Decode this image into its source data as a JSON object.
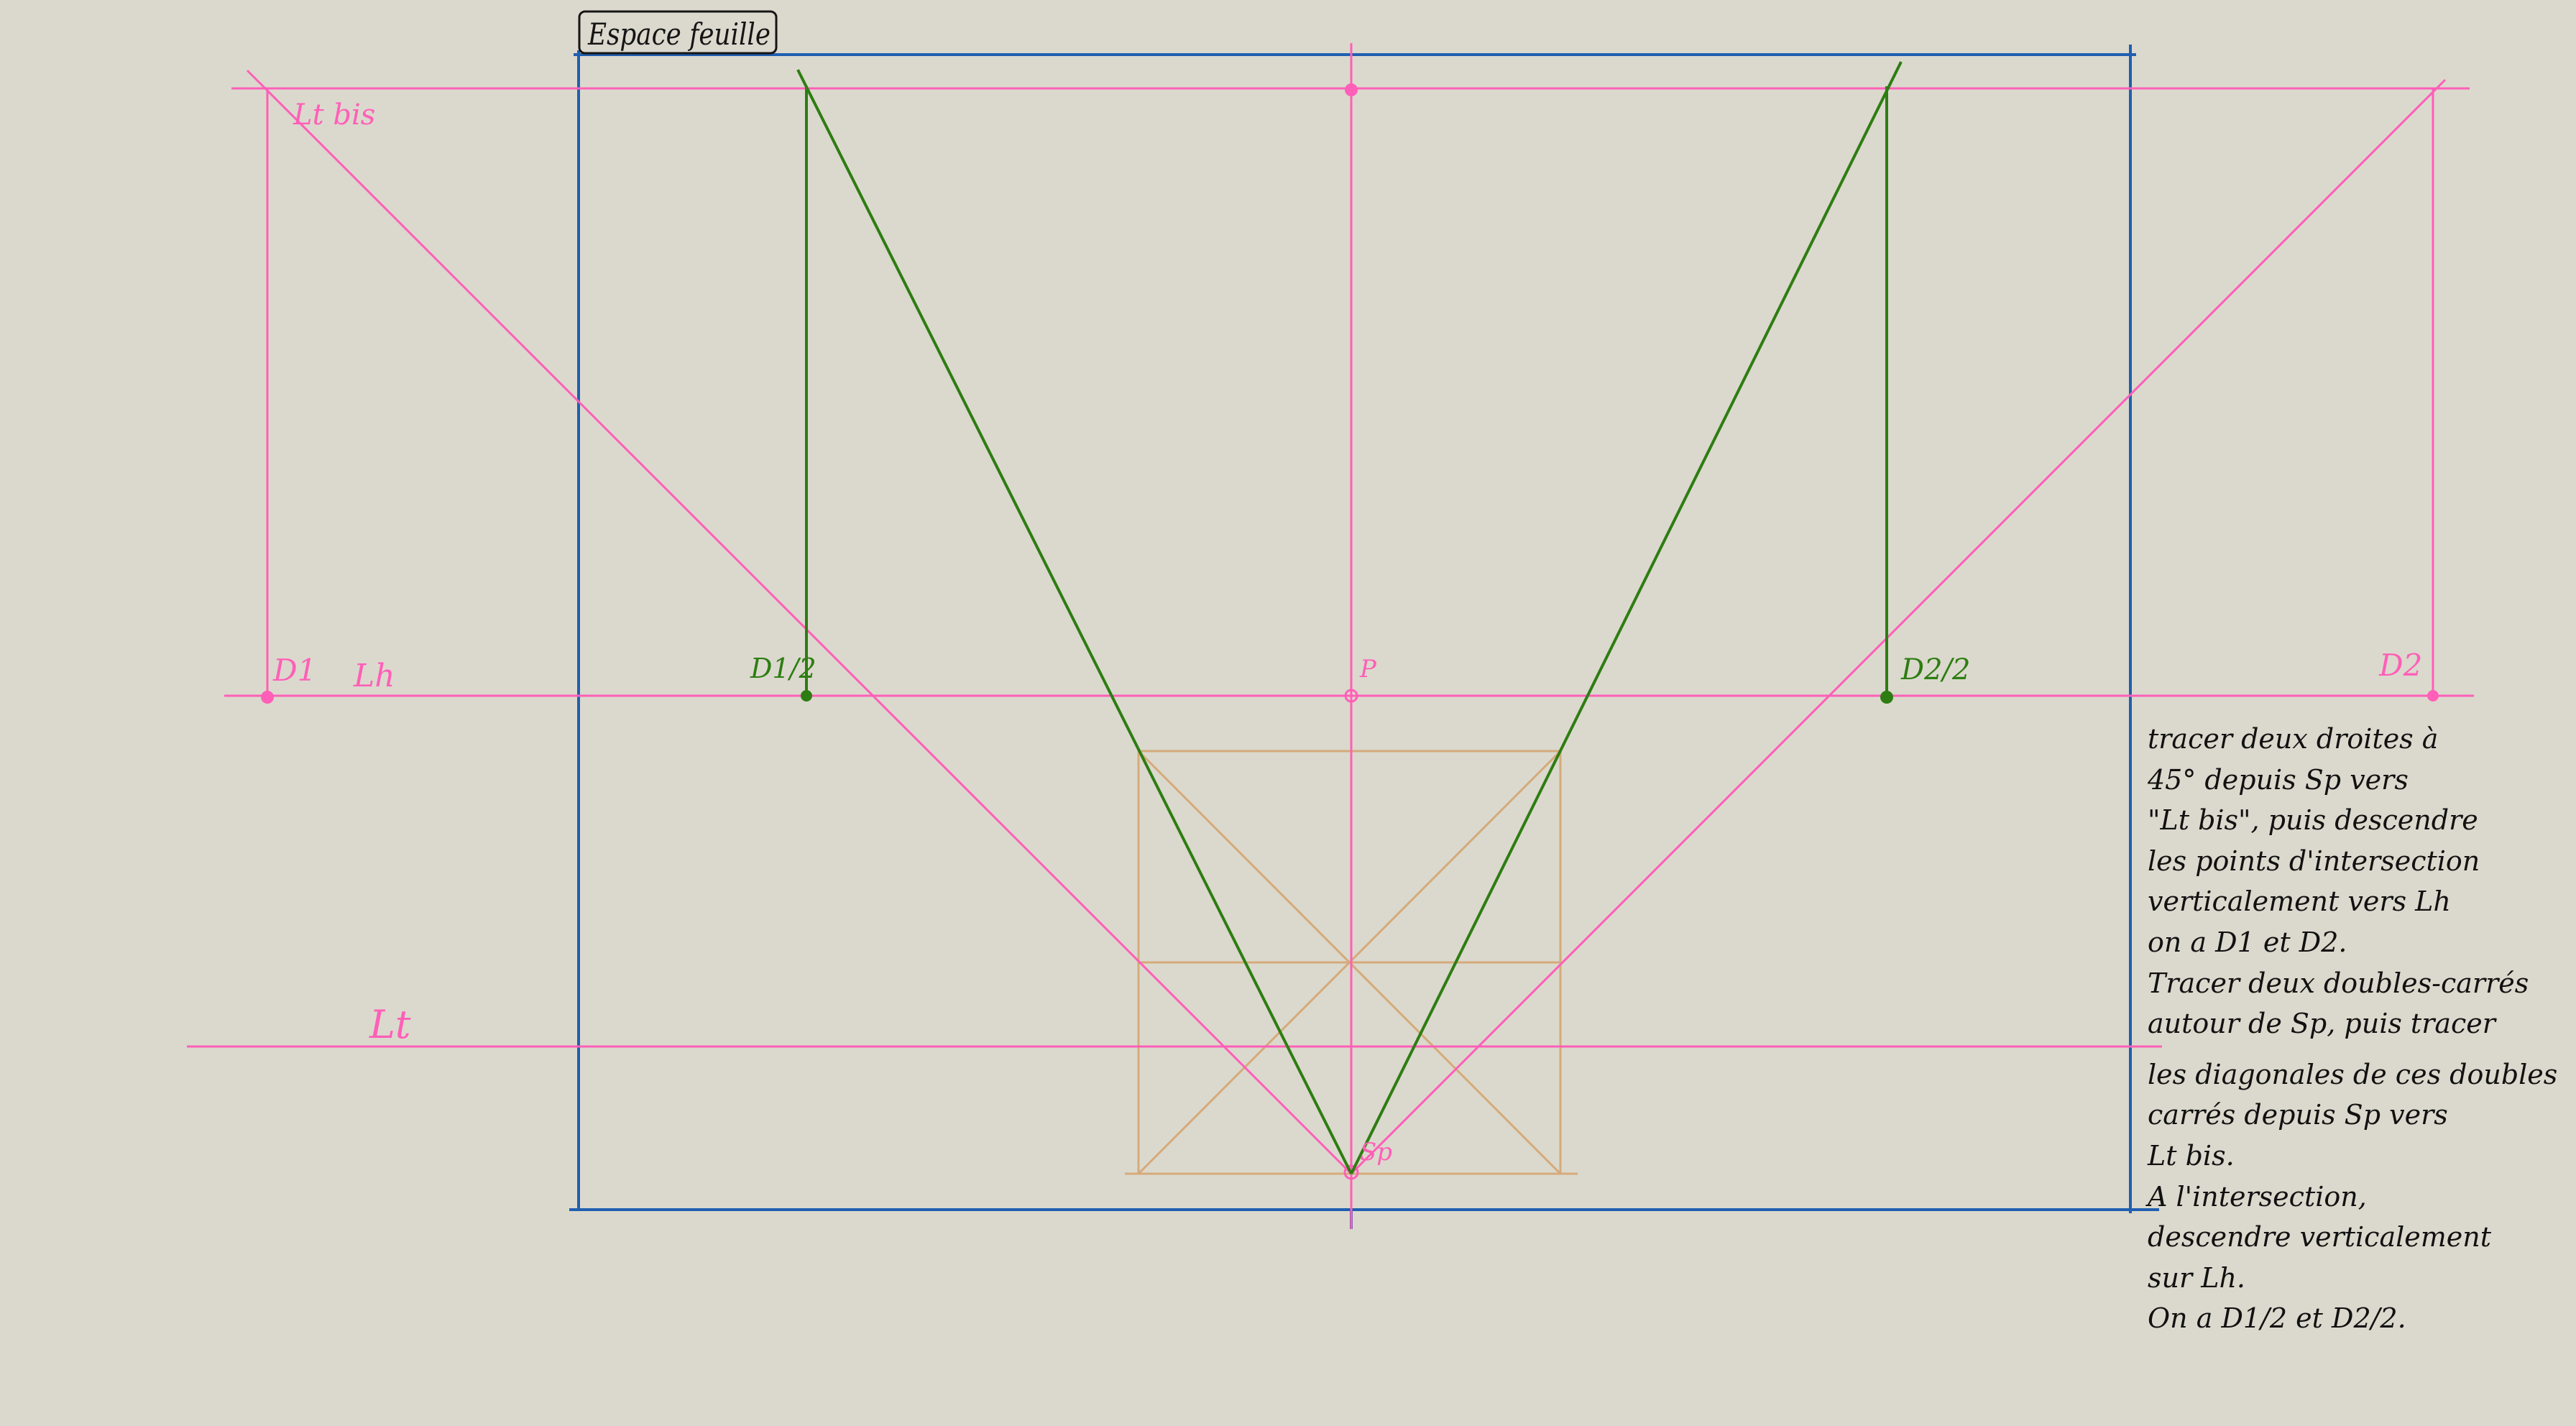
{
  "colors": {
    "background": "#dbd9cd",
    "blue": "#1f5fb0",
    "pink": "#ff5fb8",
    "green": "#2e7d12",
    "tan": "#d5aa7a",
    "ink": "#151515"
  },
  "labels": {
    "sheet": "Espace feuille",
    "lt_bis": "Lt bis",
    "d1": "D1",
    "lh": "Lh",
    "d1_half": "D1/2",
    "p": "P",
    "d2_half": "D2/2",
    "d2": "D2",
    "lt": "Lt",
    "sp": "Sp"
  },
  "notes": [
    "tracer deux droites à",
    "45° depuis Sp vers",
    "\"Lt bis\", puis descendre",
    "les points d'intersection",
    "verticalement vers Lh",
    "on a D1 et D2.",
    "Tracer deux doubles-carrés",
    "autour de Sp, puis tracer",
    "les diagonales de ces doubles",
    "carrés depuis Sp vers",
    "Lt bis.",
    "A l'intersection,",
    "descendre verticalement",
    "sur Lh.",
    "On a D1/2 et D2/2."
  ]
}
